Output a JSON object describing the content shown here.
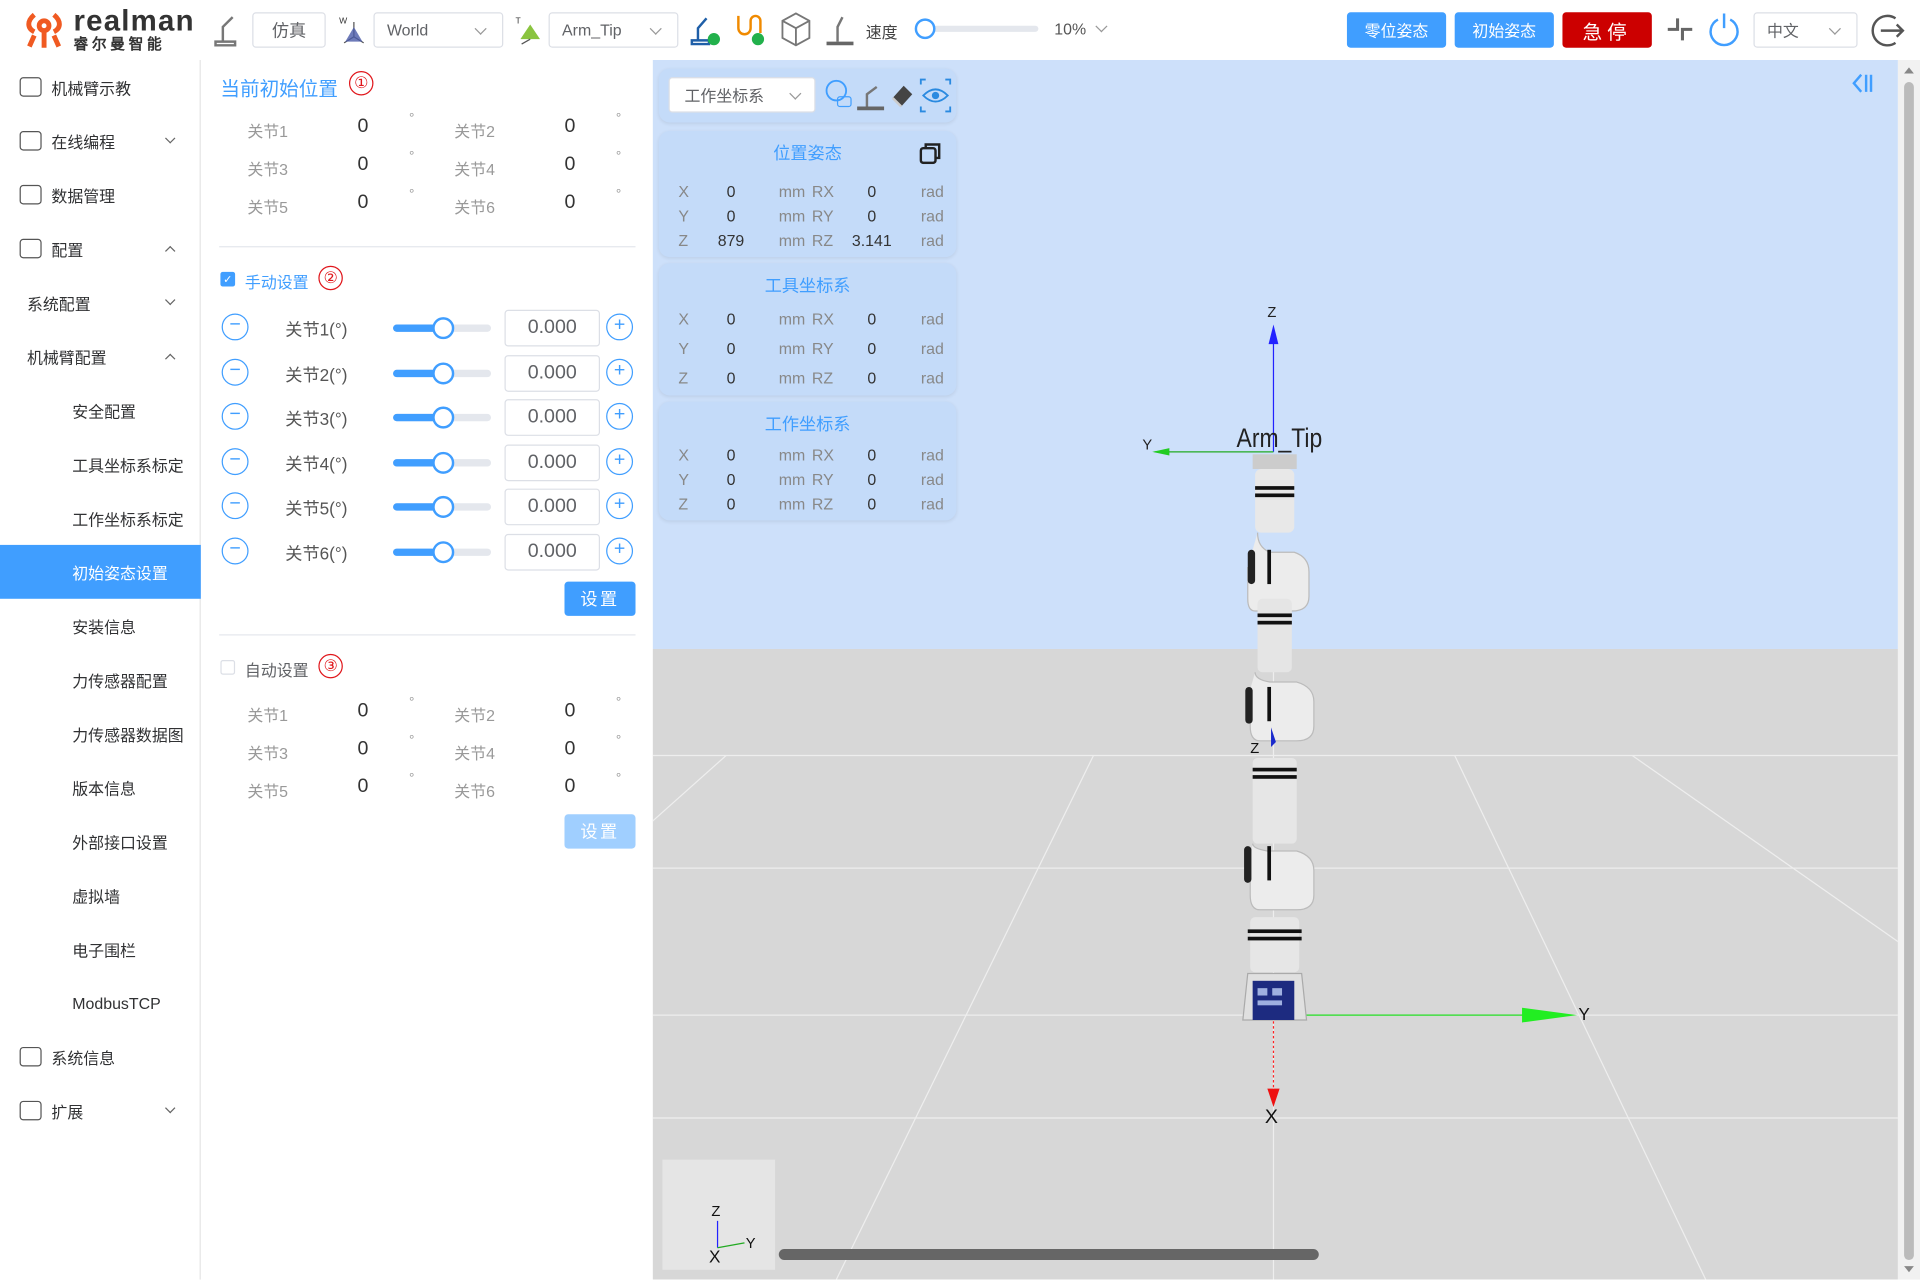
{
  "header": {
    "logo_text": "realman",
    "logo_sub": "睿尔曼智能",
    "mode": "仿真",
    "frame_select": "World",
    "tool_select": "Arm_Tip",
    "speed_label": "速度",
    "speed_value": "10%",
    "speed_fraction": 0.1,
    "zero_pose": "零位姿态",
    "init_pose": "初始姿态",
    "estop": "急停",
    "language": "中文",
    "colors": {
      "primary": "#409eff",
      "estop": "#cc0000"
    }
  },
  "sidebar": {
    "items": [
      {
        "label": "机械臂示教",
        "level": 0,
        "icon": "home-icon"
      },
      {
        "label": "在线编程",
        "level": 0,
        "icon": "monitor-code-icon",
        "chevron": "down"
      },
      {
        "label": "数据管理",
        "level": 0,
        "icon": "database-icon"
      },
      {
        "label": "配置",
        "level": 0,
        "icon": "gear-icon",
        "chevron": "up"
      },
      {
        "label": "系统配置",
        "level": 1,
        "chevron": "down"
      },
      {
        "label": "机械臂配置",
        "level": 1,
        "chevron": "up"
      },
      {
        "label": "安全配置",
        "level": 2
      },
      {
        "label": "工具坐标系标定",
        "level": 2
      },
      {
        "label": "工作坐标系标定",
        "level": 2
      },
      {
        "label": "初始姿态设置",
        "level": 2,
        "active": true
      },
      {
        "label": "安装信息",
        "level": 2
      },
      {
        "label": "力传感器配置",
        "level": 2
      },
      {
        "label": "力传感器数据图",
        "level": 2
      },
      {
        "label": "版本信息",
        "level": 2
      },
      {
        "label": "外部接口设置",
        "level": 2
      },
      {
        "label": "虚拟墙",
        "level": 2
      },
      {
        "label": "电子围栏",
        "level": 2
      },
      {
        "label": "ModbusTCP",
        "level": 2
      },
      {
        "label": "系统信息",
        "level": 0,
        "icon": "waveform-icon"
      },
      {
        "label": "扩展",
        "level": 0,
        "icon": "grid-icon",
        "chevron": "down"
      }
    ]
  },
  "current": {
    "title": "当前初始位置",
    "badge": "①",
    "unit": "°",
    "joints": [
      {
        "label": "关节1",
        "value": "0"
      },
      {
        "label": "关节2",
        "value": "0"
      },
      {
        "label": "关节3",
        "value": "0"
      },
      {
        "label": "关节4",
        "value": "0"
      },
      {
        "label": "关节5",
        "value": "0"
      },
      {
        "label": "关节6",
        "value": "0"
      }
    ]
  },
  "manual": {
    "label": "手动设置",
    "badge": "②",
    "checked": true,
    "set_button": "设置",
    "joints": [
      {
        "label": "关节1(°)",
        "value": "0.000"
      },
      {
        "label": "关节2(°)",
        "value": "0.000"
      },
      {
        "label": "关节3(°)",
        "value": "0.000"
      },
      {
        "label": "关节4(°)",
        "value": "0.000"
      },
      {
        "label": "关节5(°)",
        "value": "0.000"
      },
      {
        "label": "关节6(°)",
        "value": "0.000"
      }
    ]
  },
  "auto": {
    "label": "自动设置",
    "badge": "③",
    "checked": false,
    "set_button": "设置",
    "unit": "°",
    "joints": [
      {
        "label": "关节1",
        "value": "0"
      },
      {
        "label": "关节2",
        "value": "0"
      },
      {
        "label": "关节3",
        "value": "0"
      },
      {
        "label": "关节4",
        "value": "0"
      },
      {
        "label": "关节5",
        "value": "0"
      },
      {
        "label": "关节6",
        "value": "0"
      }
    ]
  },
  "view": {
    "frame_select": "工作坐标系",
    "tip_label": "Arm_Tip",
    "cards": [
      {
        "title": "位置姿态",
        "rows": [
          [
            "X",
            "0",
            "mm",
            "RX",
            "0",
            "rad"
          ],
          [
            "Y",
            "0",
            "mm",
            "RY",
            "0",
            "rad"
          ],
          [
            "Z",
            "879",
            "mm",
            "RZ",
            "3.141",
            "rad"
          ]
        ]
      },
      {
        "title": "工具坐标系",
        "rows": [
          [
            "X",
            "0",
            "mm",
            "RX",
            "0",
            "rad"
          ],
          [
            "Y",
            "0",
            "mm",
            "RY",
            "0",
            "rad"
          ],
          [
            "Z",
            "0",
            "mm",
            "RZ",
            "0",
            "rad"
          ]
        ]
      },
      {
        "title": "工作坐标系",
        "rows": [
          [
            "X",
            "0",
            "mm",
            "RX",
            "0",
            "rad"
          ],
          [
            "Y",
            "0",
            "mm",
            "RY",
            "0",
            "rad"
          ],
          [
            "Z",
            "0",
            "mm",
            "RZ",
            "0",
            "rad"
          ]
        ]
      }
    ],
    "axes": {
      "x": "X",
      "y": "Y",
      "z": "Z"
    }
  }
}
